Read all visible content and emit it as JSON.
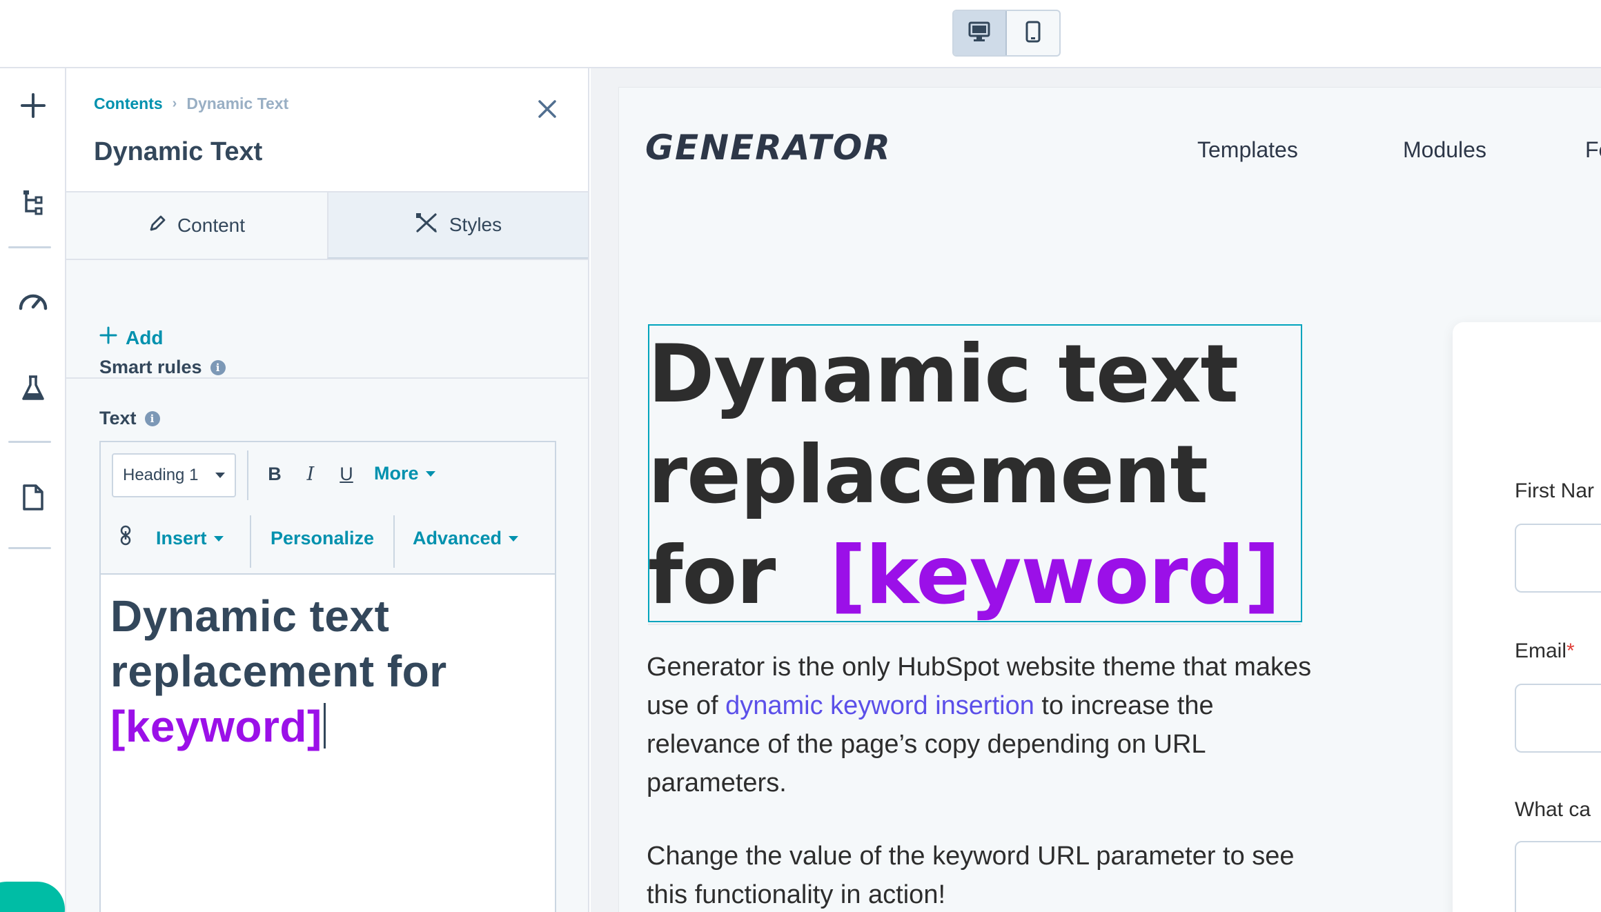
{
  "breadcrumb": {
    "root": "Contents",
    "separator": "›",
    "current": "Dynamic Text"
  },
  "panel": {
    "title": "Dynamic Text",
    "tabs": [
      {
        "label": "Content"
      },
      {
        "label": "Styles"
      }
    ],
    "smart_rules": {
      "label": "Smart rules",
      "add_label": "Add"
    },
    "text_field": {
      "label": "Text"
    }
  },
  "toolbar": {
    "block_style": "Heading 1",
    "bold": "B",
    "italic": "I",
    "underline": "U",
    "more": "More",
    "insert": "Insert",
    "personalize": "Personalize",
    "advanced": "Advanced"
  },
  "editor": {
    "line1": "Dynamic text",
    "line2": "replacement for",
    "keyword": "[keyword]"
  },
  "preview": {
    "logo": "GENERATOR",
    "nav": [
      "Templates",
      "Modules",
      "Fe"
    ],
    "hero": {
      "line1": "Dynamic text",
      "line2": "replacement",
      "line3_prefix": "for",
      "keyword": "[keyword]"
    },
    "body": {
      "p1_before": "Generator is the only HubSpot website theme that makes use of",
      "p1_link": "dynamic keyword insertion",
      "p1_after": "to increase the relevance of the page’s copy depending on URL parameters.",
      "p2": "Change the value of the keyword URL parameter to see this functionality in action!"
    },
    "form": {
      "first_name": "First Nar",
      "email": "Email",
      "required_mark": "*",
      "third": "What ca"
    }
  },
  "colors": {
    "accent_teal": "#0091ae",
    "keyword_purple": "#9b10e8",
    "link_blue": "#5b4fe9",
    "selection_border": "#00a4bd"
  },
  "icons": {
    "rail": [
      "plus-icon",
      "tree-icon",
      "gauge-icon",
      "flask-icon",
      "page-icon"
    ],
    "device": [
      "desktop-icon",
      "mobile-icon"
    ]
  }
}
